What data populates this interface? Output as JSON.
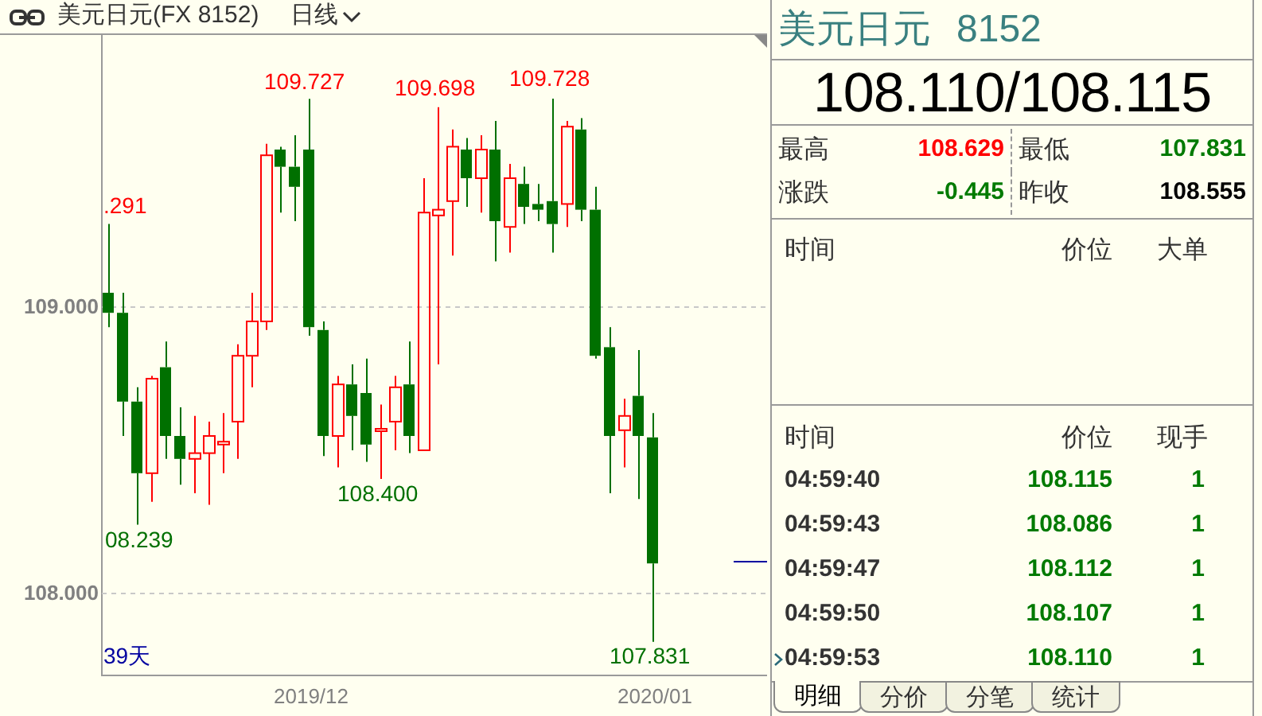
{
  "header": {
    "title": "美元日元(FX 8152)",
    "period": "日线"
  },
  "chart": {
    "y_ticks": [
      "109.000",
      "108.000"
    ],
    "x_labels": [
      "2019/12",
      "2020/01"
    ],
    "span": "39天",
    "annotations": [
      {
        "text": ".291",
        "kind": "high"
      },
      {
        "text": "109.727",
        "kind": "high"
      },
      {
        "text": "109.698",
        "kind": "high"
      },
      {
        "text": "109.728",
        "kind": "high"
      },
      {
        "text": "08.239",
        "kind": "low"
      },
      {
        "text": "108.400",
        "kind": "low"
      },
      {
        "text": "107.831",
        "kind": "low"
      }
    ]
  },
  "quote": {
    "name": "美元日元",
    "code": "8152",
    "price": "108.110/108.115"
  },
  "stats": [
    {
      "label": "最高",
      "value": "108.629",
      "color": "#ff0000"
    },
    {
      "label": "最低",
      "value": "107.831",
      "color": "#007a00"
    },
    {
      "label": "涨跌",
      "value": "-0.445",
      "color": "#007a00"
    },
    {
      "label": "昨收",
      "value": "108.555",
      "color": "#000000"
    }
  ],
  "big_orders": {
    "columns": [
      "时间",
      "价位",
      "大单"
    ]
  },
  "ticks": {
    "columns": [
      "时间",
      "价位",
      "现手"
    ],
    "rows": [
      {
        "time": "04:59:40",
        "price": "108.115",
        "volume": "1",
        "selected": false
      },
      {
        "time": "04:59:43",
        "price": "108.086",
        "volume": "1",
        "selected": false
      },
      {
        "time": "04:59:47",
        "price": "108.112",
        "volume": "1",
        "selected": false
      },
      {
        "time": "04:59:50",
        "price": "108.107",
        "volume": "1",
        "selected": false
      },
      {
        "time": "04:59:53",
        "price": "108.110",
        "volume": "1",
        "selected": true
      }
    ]
  },
  "tabs": [
    {
      "label": "明细",
      "selected": true
    },
    {
      "label": "分价",
      "selected": false
    },
    {
      "label": "分笔",
      "selected": false
    },
    {
      "label": "统计",
      "selected": false
    }
  ]
}
